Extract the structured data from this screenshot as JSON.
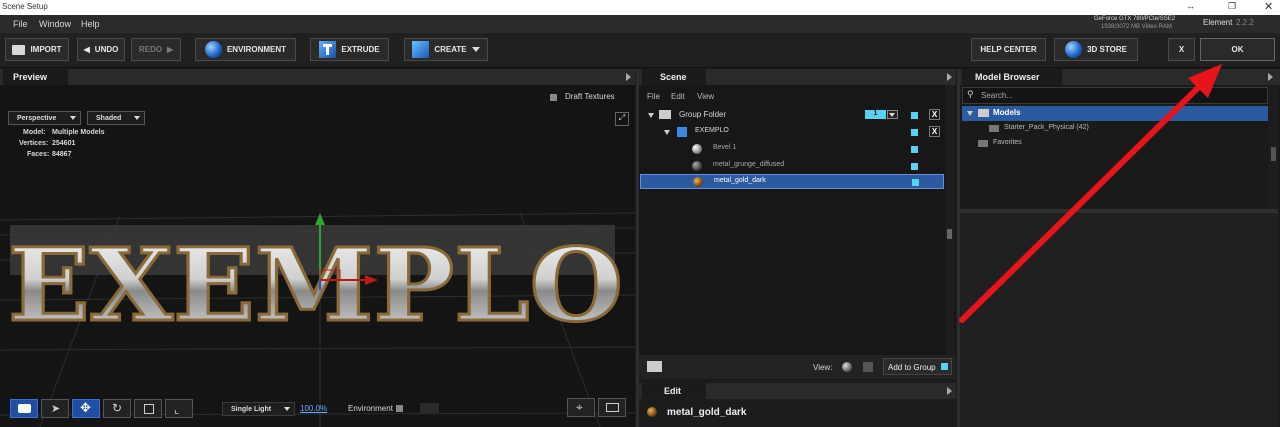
{
  "window": {
    "title": "Scene Setup",
    "gpu": "GeForce GTX 780/PCIe/SSE2",
    "vram": "1938/3072 MB Video RAM",
    "app_name": "Element",
    "version": "2.2.2"
  },
  "menu": [
    "File",
    "Window",
    "Help"
  ],
  "toolbar": {
    "import": "IMPORT",
    "undo": "UNDO",
    "redo": "REDO",
    "environment": "ENVIRONMENT",
    "extrude": "EXTRUDE",
    "create": "CREATE",
    "help_center": "HELP CENTER",
    "store": "3D STORE",
    "close": "X",
    "ok": "OK"
  },
  "preview": {
    "tab": "Preview",
    "draft_textures": "Draft Textures",
    "view_mode": "Perspective",
    "shading": "Shaded",
    "model_label": "Model:",
    "model_value": "Multiple Models",
    "vertices_label": "Vertices:",
    "vertices_value": "254601",
    "faces_label": "Faces:",
    "faces_value": "84867",
    "render_text": "EXEMPLO",
    "light_mode": "Single Light",
    "zoom": "100.0%",
    "environment_label": "Environment"
  },
  "scene": {
    "tab": "Scene",
    "menu": [
      "File",
      "Edit",
      "View"
    ],
    "group_folder": "Group Folder",
    "group_count": "1",
    "object": "EXEMPLO",
    "materials": [
      "Bevel 1",
      "metal_grunge_diffused",
      "metal_gold_dark"
    ],
    "selected_material": "metal_gold_dark",
    "view_label": "View:",
    "add_to_group": "Add to Group",
    "close_x": "X"
  },
  "edit": {
    "tab": "Edit",
    "material": "metal_gold_dark"
  },
  "model_browser": {
    "tab": "Model Browser",
    "search_placeholder": "Search...",
    "models": "Models",
    "starter_pack": "Starter_Pack_Physical (42)",
    "favorites": "Favorites"
  },
  "colors": {
    "accent_blue": "#1f4ea3",
    "selection_blue": "#2c5aa0",
    "cyan": "#5ad0f2",
    "annotation_red": "#e8141b"
  }
}
